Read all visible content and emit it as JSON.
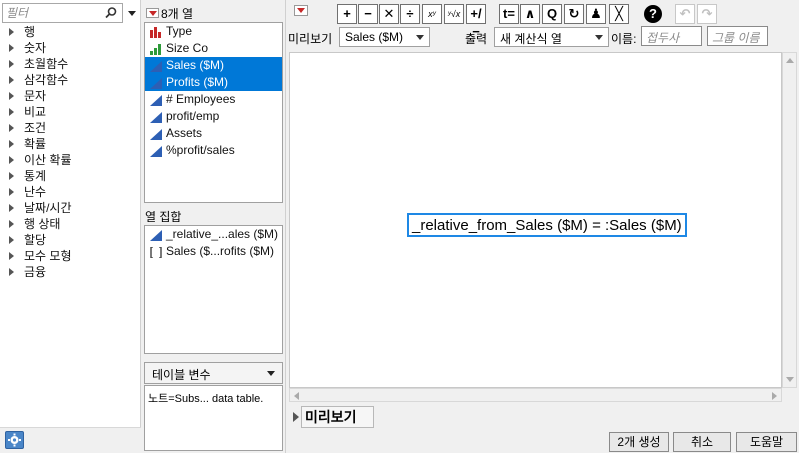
{
  "filter": {
    "placeholder": "필터"
  },
  "functions": [
    "행",
    "숫자",
    "초월함수",
    "삼각함수",
    "문자",
    "비교",
    "조건",
    "확률",
    "이산 확률",
    "통계",
    "난수",
    "날짜/시간",
    "행 상태",
    "할당",
    "모수 모형",
    "금융"
  ],
  "columns": {
    "count_label": "8개 열",
    "items": [
      {
        "name": "Type",
        "icon": "nominal-bar-icon",
        "selected": false
      },
      {
        "name": "Size Co",
        "icon": "ordinal-bar-icon",
        "selected": false
      },
      {
        "name": "Sales ($M)",
        "icon": "continuous-icon",
        "selected": true
      },
      {
        "name": "Profits ($M)",
        "icon": "continuous-icon",
        "selected": true
      },
      {
        "name": "# Employees",
        "icon": "continuous-icon",
        "selected": false
      },
      {
        "name": "profit/emp",
        "icon": "continuous-icon",
        "selected": false
      },
      {
        "name": "Assets",
        "icon": "continuous-icon",
        "selected": false
      },
      {
        "name": "%profit/sales",
        "icon": "continuous-icon",
        "selected": false
      }
    ]
  },
  "column_set": {
    "label": "열 집합",
    "items": [
      {
        "name": "_relative_...ales ($M)",
        "icon": "continuous-icon"
      },
      {
        "name": "Sales ($...rofits ($M)",
        "icon": "bracket-icon"
      }
    ]
  },
  "table_var": {
    "label": "테이블 변수"
  },
  "note": {
    "text": "노트=Subs... data table."
  },
  "toolbar": {
    "buttons": [
      "+",
      "−",
      "✕",
      "÷",
      "xʸ",
      "ʸ√x",
      "+/−",
      "t=",
      "∧",
      "Q",
      "↻",
      "♟",
      "╳"
    ],
    "help": "?"
  },
  "preview_bar": {
    "preview_label": "미리보기",
    "preview_value": "Sales ($M)",
    "output_label": "출력",
    "output_value": "새 계산식 열",
    "name_label": "이름:",
    "name_placeholder": "접두사",
    "group_placeholder": "그룹 이름"
  },
  "formula": {
    "text": "_relative_from_Sales ($M) = :Sales ($M)",
    "accent": "#1e88e5"
  },
  "preview_section": {
    "label": "미리보기"
  },
  "buttons": {
    "generate": "2개 생성",
    "cancel": "취소",
    "help": "도움말"
  },
  "colors": {
    "selection": "#0078d7",
    "menu_triangle": "#c62828"
  }
}
